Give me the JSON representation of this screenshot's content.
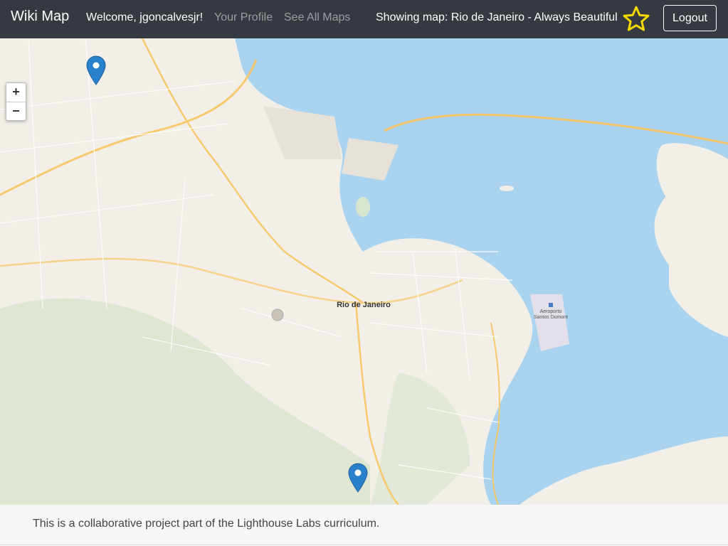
{
  "navbar": {
    "brand": "Wiki Map",
    "welcome": "Welcome, jgoncalvesjr!",
    "your_profile": "Your Profile",
    "see_all_maps": "See All Maps",
    "showing_map": "Showing map: Rio de Janeiro - Always Beautiful",
    "favorite_icon": "star-icon",
    "logout": "Logout"
  },
  "map": {
    "zoom_in": "+",
    "zoom_out": "−",
    "city_label": "Rio de Janeiro",
    "airport_label_1": "Aeroporto",
    "airport_label_2": "Santos Dumont",
    "marker_count": 2
  },
  "footer": {
    "text": "This is a collaborative project part of the Lighthouse Labs curriculum."
  },
  "colors": {
    "navbar_bg": "#343a40",
    "star": "#f5d800",
    "marker": "#2a81cb",
    "water": "#a9d3ef",
    "land": "#f2efe9"
  }
}
